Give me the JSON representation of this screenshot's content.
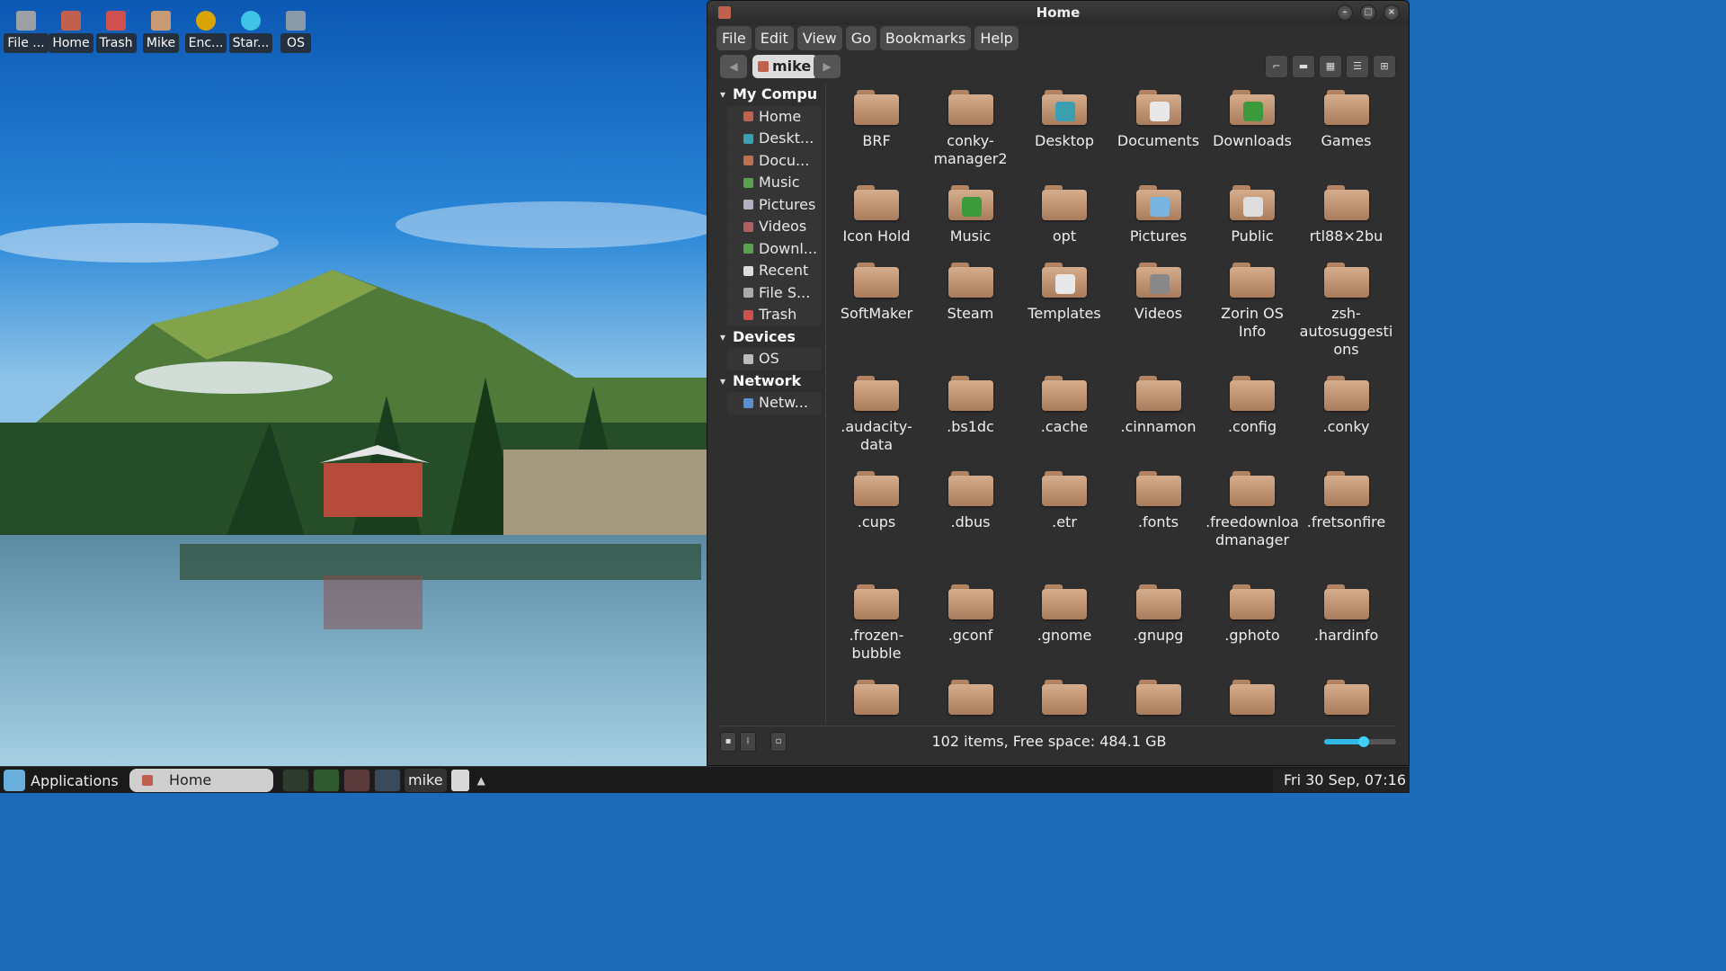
{
  "desktop": {
    "icons": [
      {
        "label": "File ...",
        "icon": "file-system-icon",
        "color": "#9aa0a6"
      },
      {
        "label": "Home",
        "icon": "home-icon",
        "color": "#c0614d"
      },
      {
        "label": "Trash",
        "icon": "trash-icon",
        "color": "#d05050"
      },
      {
        "label": "Mike",
        "icon": "folder-icon",
        "color": "#c89a74"
      },
      {
        "label": "Enc...",
        "icon": "encrypted-icon",
        "color": "#d9a400"
      },
      {
        "label": "Star...",
        "icon": "start-icon",
        "color": "#3fc3e6"
      },
      {
        "label": "OS",
        "icon": "drive-icon",
        "color": "#8a9aa8"
      }
    ]
  },
  "window": {
    "title": "Home",
    "menu": [
      "File",
      "Edit",
      "View",
      "Go",
      "Bookmarks",
      "Help"
    ],
    "breadcrumb": "mike",
    "sidebar": {
      "sections": [
        {
          "title": "My Compu",
          "items": [
            {
              "label": "Home",
              "color": "#c0614d"
            },
            {
              "label": "Deskt...",
              "color": "#3aa0b0"
            },
            {
              "label": "Docu...",
              "color": "#c07050"
            },
            {
              "label": "Music",
              "color": "#5aa050"
            },
            {
              "label": "Pictures",
              "color": "#b0b0c0"
            },
            {
              "label": "Videos",
              "color": "#b06060"
            },
            {
              "label": "Downl...",
              "color": "#5aa050"
            },
            {
              "label": "Recent",
              "color": "#dddddd"
            },
            {
              "label": "File S...",
              "color": "#aaaaaa"
            },
            {
              "label": "Trash",
              "color": "#d05050"
            }
          ]
        },
        {
          "title": "Devices",
          "items": [
            {
              "label": "OS",
              "color": "#bbbbbb"
            }
          ]
        },
        {
          "title": "Network",
          "items": [
            {
              "label": "Netw...",
              "color": "#5a8fd0"
            }
          ]
        }
      ]
    },
    "files": [
      {
        "name": "BRF"
      },
      {
        "name": "conky-manager2"
      },
      {
        "name": "Desktop",
        "emblem": "#3aa0b0"
      },
      {
        "name": "Documents",
        "emblem": "#e8e8e8"
      },
      {
        "name": "Downloads",
        "emblem": "#3c9a3c"
      },
      {
        "name": "Games"
      },
      {
        "name": "Icon Hold"
      },
      {
        "name": "Music",
        "emblem": "#3c9a3c"
      },
      {
        "name": "opt"
      },
      {
        "name": "Pictures",
        "emblem": "#7ab4e0"
      },
      {
        "name": "Public",
        "emblem": "#dddddd"
      },
      {
        "name": "rtl88×2bu"
      },
      {
        "name": "SoftMaker"
      },
      {
        "name": "Steam"
      },
      {
        "name": "Templates",
        "emblem": "#e8e8e8"
      },
      {
        "name": "Videos",
        "emblem": "#888888"
      },
      {
        "name": "Zorin OS Info"
      },
      {
        "name": "zsh-autosuggestions"
      },
      {
        "name": ".audacity-data"
      },
      {
        "name": ".bs1dc"
      },
      {
        "name": ".cache"
      },
      {
        "name": ".cinnamon"
      },
      {
        "name": ".config"
      },
      {
        "name": ".conky"
      },
      {
        "name": ".cups"
      },
      {
        "name": ".dbus"
      },
      {
        "name": ".etr"
      },
      {
        "name": ".fonts"
      },
      {
        "name": ".freedownloadmanager"
      },
      {
        "name": ".fretsonfire"
      },
      {
        "name": ".frozen-bubble"
      },
      {
        "name": ".gconf"
      },
      {
        "name": ".gnome"
      },
      {
        "name": ".gnupg"
      },
      {
        "name": ".gphoto"
      },
      {
        "name": ".hardinfo"
      },
      {
        "name": ""
      },
      {
        "name": ""
      },
      {
        "name": ""
      },
      {
        "name": ""
      },
      {
        "name": ""
      },
      {
        "name": ""
      }
    ],
    "status": "102 items, Free space: 484.1 GB",
    "zoom_fraction": 0.55
  },
  "taskbar": {
    "apps_label": "Applications",
    "active_task": "Home",
    "user": "mike",
    "clock": "Fri 30 Sep, 07:16"
  },
  "colors": {
    "window_bg": "#2f2f2f",
    "accent": "#2fb9e4",
    "folder": "#c89a74"
  }
}
